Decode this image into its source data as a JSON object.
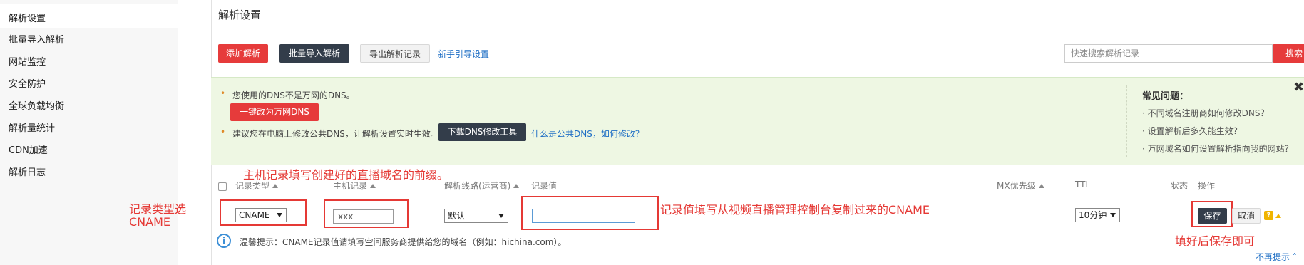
{
  "sidebar": {
    "items": [
      {
        "label": "解析设置"
      },
      {
        "label": "批量导入解析"
      },
      {
        "label": "网站监控"
      },
      {
        "label": "安全防护"
      },
      {
        "label": "全球负载均衡"
      },
      {
        "label": "解析量统计"
      },
      {
        "label": "CDN加速"
      },
      {
        "label": "解析日志"
      }
    ]
  },
  "page": {
    "title": "解析设置"
  },
  "toolbar": {
    "add_label": "添加解析",
    "batch_import_label": "批量导入解析",
    "export_label": "导出解析记录",
    "guide_link": "新手引导设置",
    "search_placeholder": "快速搜索解析记录",
    "search_label": "搜索"
  },
  "notice": {
    "line1": "您使用的DNS不是万网的DNS。",
    "change_dns_button": "一键改为万网DNS",
    "line2": "建议您在电脑上修改公共DNS，让解析设置实时生效。",
    "download_tool_button": "下载DNS修改工具",
    "what_is_link": "什么是公共DNS，如何修改？",
    "faq_title": "常见问题：",
    "faq": [
      "· 不同域名注册商如何修改DNS？",
      "· 设置解析后多久能生效？",
      "· 万网域名如何设置解析指向我的网站？"
    ],
    "close_glyph": "✖"
  },
  "annotations": {
    "host_prefix": "主机记录填写创建好的直播域名的前缀。",
    "record_type_line1": "记录类型选",
    "record_type_line2": "CNAME",
    "record_value": "记录值填写从视频直播管理控制台复制过来的CNAME",
    "save_hint": "填好后保存即可"
  },
  "table": {
    "headers": {
      "record_type": "记录类型",
      "host": "主机记录",
      "line": "解析线路(运营商)",
      "value": "记录值",
      "mx": "MX优先级",
      "ttl": "TTL",
      "status": "状态",
      "action": "操作"
    },
    "row": {
      "record_type": "CNAME",
      "host": "xxx",
      "line": "默认",
      "value": "",
      "mx": "--",
      "ttl": "10分钟",
      "save_label": "保存",
      "cancel_label": "取消",
      "help_glyph": "?"
    }
  },
  "tip": {
    "text": "温馨提示：CNAME记录值请填写空间服务商提供给您的域名（例如：hichina.com）。",
    "info_glyph": "i"
  },
  "footer": {
    "hide_tip_link": "不再提示"
  },
  "colors": {
    "accent_red": "#e63b3b",
    "dark_button": "#333d4a",
    "notice_bg": "#eef7e3",
    "link_blue": "#1f6fc5",
    "annotation_red": "#e53935"
  }
}
